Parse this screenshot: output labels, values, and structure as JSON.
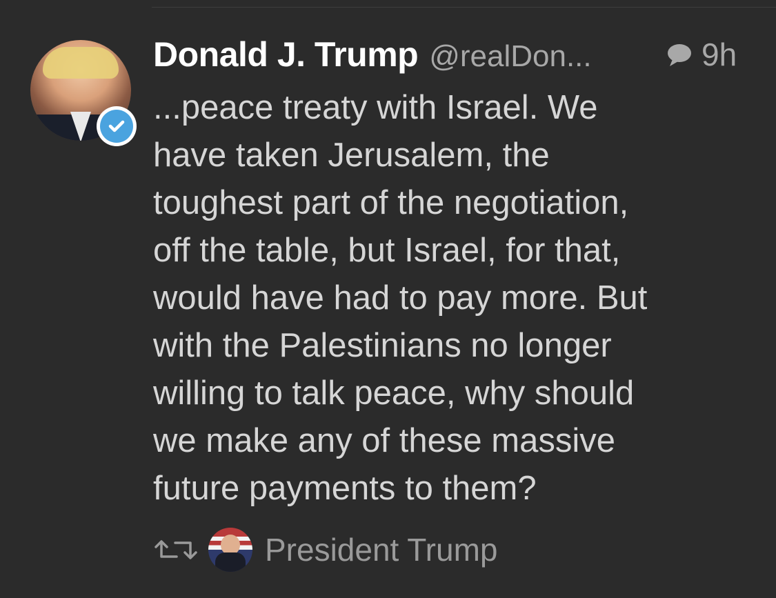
{
  "tweet": {
    "display_name": "Donald J. Trump",
    "handle": "@realDon...",
    "time": "9h",
    "body": "...peace treaty with Israel. We\nhave taken Jerusalem, the\ntoughest part of the negotiation,\noff the table, but Israel, for that,\nwould have had to pay more. But\nwith the Palestinians no longer\nwilling to talk peace, why should\nwe make any of these massive\nfuture payments to them?",
    "verified": true,
    "icons": {
      "reply": "reply-bubble-icon",
      "verified": "verified-check-icon",
      "retweet": "retweet-icon"
    }
  },
  "footer": {
    "retweeted_by": "President Trump"
  },
  "colors": {
    "background": "#2b2b2b",
    "verified_blue": "#4aa3df",
    "secondary_text": "#a8a8a8",
    "body_text": "#d6d6d6"
  }
}
